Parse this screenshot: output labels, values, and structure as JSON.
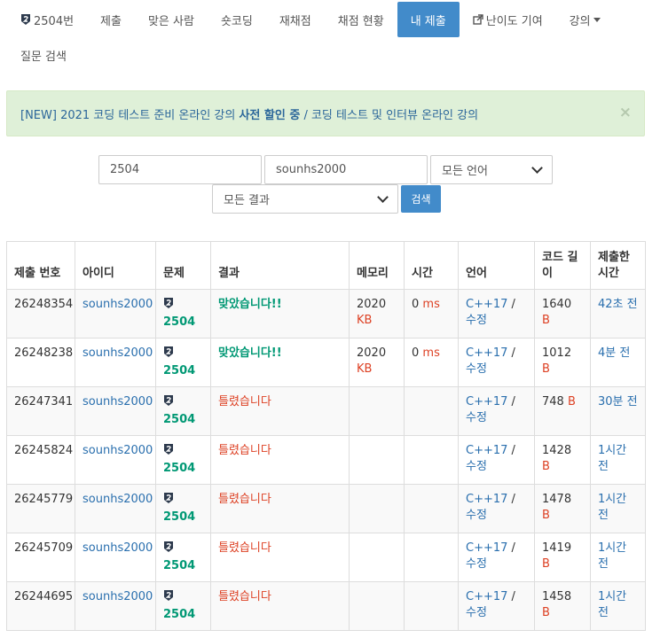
{
  "nav": {
    "row1": [
      {
        "label": "2504번",
        "icon": "tier-badge-icon"
      },
      {
        "label": "제출"
      },
      {
        "label": "맞은 사람"
      },
      {
        "label": "숏코딩"
      },
      {
        "label": "재채점"
      },
      {
        "label": "채점 현황"
      },
      {
        "label": "내 제출",
        "active": true
      },
      {
        "label": "난이도 기여",
        "icon": "external-link-icon"
      },
      {
        "label": "강의",
        "dropdown": true
      }
    ],
    "row2": [
      {
        "label": "질문 검색"
      }
    ]
  },
  "alert": {
    "prefix": "[NEW] 2021 코딩 테스트 준비 온라인 강의 ",
    "bold": "사전 할인 중",
    "suffix": " / 코딩 테스트 및 인터뷰 온라인 강의",
    "close": "×"
  },
  "filters": {
    "problem_id": "2504",
    "user_id": "sounhs2000",
    "language": "모든 언어",
    "result": "모든 결과",
    "search_button": "검색"
  },
  "table": {
    "headers": [
      "제출 번호",
      "아이디",
      "문제",
      "결과",
      "메모리",
      "시간",
      "언어",
      "코드 길이",
      "제출한 시간"
    ],
    "memory_unit": "KB",
    "time_unit": "ms",
    "length_unit": "B",
    "rows": [
      {
        "id": "26248354",
        "user": "sounhs2000",
        "problem": "2504",
        "result": "맞았습니다!!",
        "status": "ac",
        "memory": "2020",
        "time": "0",
        "lang": "C++17",
        "edit": "수정",
        "length": "1640",
        "submitted": "42초 전"
      },
      {
        "id": "26248238",
        "user": "sounhs2000",
        "problem": "2504",
        "result": "맞았습니다!!",
        "status": "ac",
        "memory": "2020",
        "time": "0",
        "lang": "C++17",
        "edit": "수정",
        "length": "1012",
        "submitted": "4분 전"
      },
      {
        "id": "26247341",
        "user": "sounhs2000",
        "problem": "2504",
        "result": "틀렸습니다",
        "status": "wa",
        "memory": "",
        "time": "",
        "lang": "C++17",
        "edit": "수정",
        "length": "748",
        "submitted": "30분 전"
      },
      {
        "id": "26245824",
        "user": "sounhs2000",
        "problem": "2504",
        "result": "틀렸습니다",
        "status": "wa",
        "memory": "",
        "time": "",
        "lang": "C++17",
        "edit": "수정",
        "length": "1428",
        "submitted": "1시간 전"
      },
      {
        "id": "26245779",
        "user": "sounhs2000",
        "problem": "2504",
        "result": "틀렸습니다",
        "status": "wa",
        "memory": "",
        "time": "",
        "lang": "C++17",
        "edit": "수정",
        "length": "1478",
        "submitted": "1시간 전"
      },
      {
        "id": "26245709",
        "user": "sounhs2000",
        "problem": "2504",
        "result": "틀렸습니다",
        "status": "wa",
        "memory": "",
        "time": "",
        "lang": "C++17",
        "edit": "수정",
        "length": "1419",
        "submitted": "1시간 전"
      },
      {
        "id": "26244695",
        "user": "sounhs2000",
        "problem": "2504",
        "result": "틀렸습니다",
        "status": "wa",
        "memory": "",
        "time": "",
        "lang": "C++17",
        "edit": "수정",
        "length": "1458",
        "submitted": "1시간 전"
      }
    ]
  },
  "colors": {
    "accent": "#428bca",
    "link": "#2a6fae",
    "accepted": "#009874",
    "wrong": "#dd4124",
    "alert_bg": "#dff0d8",
    "tier_badge": "#2d3a4d"
  }
}
